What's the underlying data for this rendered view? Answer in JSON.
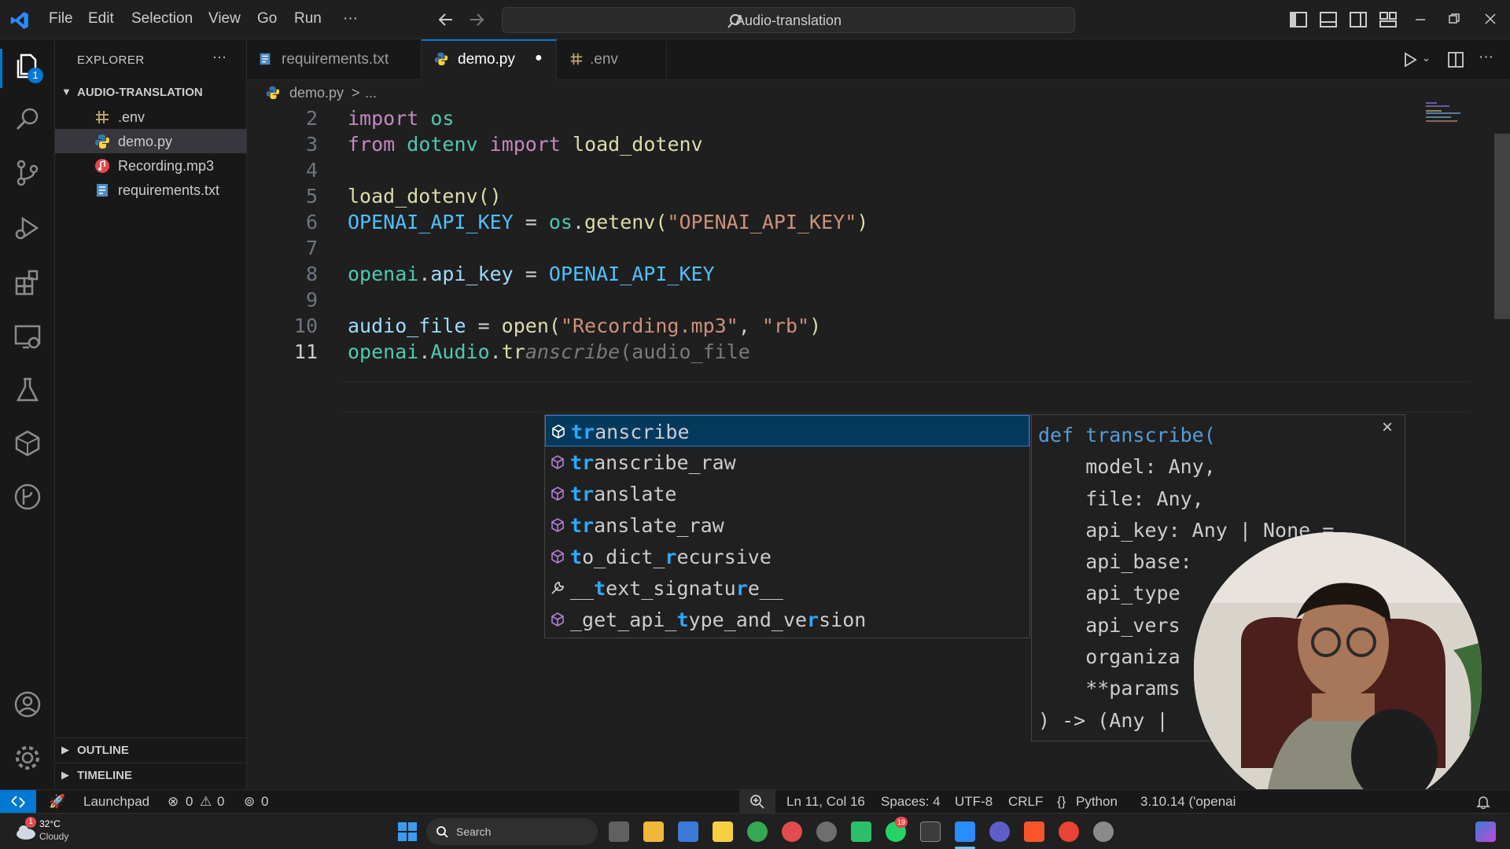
{
  "titlebar": {
    "menu": [
      "File",
      "Edit",
      "Selection",
      "View",
      "Go",
      "Run",
      "···"
    ],
    "search_text": "Audio-translation"
  },
  "activitybar": {
    "explorer_badge": "1",
    "icons": [
      "files-icon",
      "search-icon",
      "source-control-icon",
      "run-debug-icon",
      "extensions-icon",
      "remote-explorer-icon",
      "testing-icon",
      "docker-icon",
      "git-graph-icon",
      "account-icon",
      "gear-icon"
    ]
  },
  "sidebar": {
    "title": "EXPLORER",
    "more": "···",
    "project": "AUDIO-TRANSLATION",
    "files": [
      {
        "name": ".env",
        "icon": "env-file-icon"
      },
      {
        "name": "demo.py",
        "icon": "python-file-icon"
      },
      {
        "name": "Recording.mp3",
        "icon": "audio-file-icon"
      },
      {
        "name": "requirements.txt",
        "icon": "text-file-icon"
      }
    ],
    "outline": "OUTLINE",
    "timeline": "TIMELINE"
  },
  "tabs": [
    {
      "label": "requirements.txt",
      "active": false
    },
    {
      "label": "demo.py",
      "active": true,
      "modified_dot": "●"
    },
    {
      "label": ".env",
      "active": false
    }
  ],
  "breadcrumb": {
    "file": "demo.py",
    "sep": ">",
    "rest": "..."
  },
  "editor": {
    "line_numbers": [
      "2",
      "3",
      "4",
      "5",
      "6",
      "7",
      "8",
      "9",
      "10",
      "11"
    ],
    "line2": {
      "kw": "import",
      "mod": "os"
    },
    "line3": {
      "kw1": "from",
      "mod": "dotenv",
      "kw2": "import",
      "fn": "load_dotenv"
    },
    "line5": {
      "fn": "load_dotenv",
      "punct": "()"
    },
    "line6": {
      "const": "OPENAI_API_KEY",
      "eq": " = ",
      "mod": "os",
      "dot": ".",
      "fn": "getenv",
      "open": "(",
      "str": "\"OPENAI_API_KEY\"",
      "close": ")"
    },
    "line8": {
      "mod": "openai",
      "dot": ".",
      "attr": "api_key",
      "eq": " = ",
      "const": "OPENAI_API_KEY"
    },
    "line10": {
      "var": "audio_file",
      "eq": " = ",
      "fn": "open",
      "open": "(",
      "str1": "\"Recording.mp3\"",
      "comma": ", ",
      "str2": "\"rb\"",
      "close": ")"
    },
    "line11": {
      "mod": "openai",
      "dot1": ".",
      "cls": "Audio",
      "dot2": ".",
      "typed": "tr",
      "ghost_fn": "anscribe",
      "ghost_args": "(audio_file"
    }
  },
  "suggest": [
    {
      "pre": "",
      "hl": "tr",
      "post": "anscribe",
      "icon": "method-icon"
    },
    {
      "pre": "",
      "hl": "tr",
      "post": "anscribe_raw",
      "icon": "method-icon"
    },
    {
      "pre": "",
      "hl": "tr",
      "post": "anslate",
      "icon": "method-icon"
    },
    {
      "pre": "",
      "hl": "tr",
      "post": "anslate_raw",
      "icon": "method-icon"
    },
    {
      "pre": "",
      "hl": "t",
      "post": "o_dict_",
      "hl2": "r",
      "post2": "ecursive",
      "icon": "method-icon"
    },
    {
      "pre": "__",
      "hl": "t",
      "post": "ext_signatu",
      "hl2": "r",
      "post2": "e__",
      "icon": "wrench-icon"
    },
    {
      "pre": "_get_api_",
      "hl": "t",
      "post": "ype_and_ve",
      "hl2": "r",
      "post2": "sion",
      "icon": "method-icon"
    }
  ],
  "details": {
    "close": "×",
    "lines": [
      "def transcribe(",
      "    model: Any,",
      "    file: Any,",
      "    api_key: Any | None =",
      "    api_base:",
      "    api_type",
      "    api_vers",
      "    organiza",
      "    **params",
      ") -> (Any |"
    ]
  },
  "statusbar": {
    "launchpad": "Launchpad",
    "errors": "0",
    "warnings": "0",
    "ports": "0",
    "position": "Ln 11, Col 16",
    "spaces": "Spaces: 4",
    "encoding": "UTF-8",
    "eol": "CRLF",
    "language": "Python",
    "interpreter": "3.10.14 ('openai"
  },
  "taskbar": {
    "weather_badge": "1",
    "temp": "32°C",
    "condition": "Cloudy",
    "search": "Search",
    "whatsapp_badge": "19"
  },
  "colors": {
    "accent": "#0078d4",
    "selection": "#04395e",
    "highlight": "#2aaaff"
  }
}
